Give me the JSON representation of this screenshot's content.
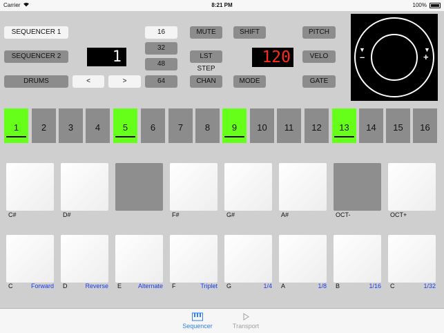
{
  "status_bar": {
    "carrier": "Carrier",
    "wifi_icon": "wifi-icon",
    "time": "8:21 PM",
    "battery": "100%"
  },
  "left_buttons": {
    "sequencer1": "SEQUENCER 1",
    "sequencer2": "SEQUENCER 2",
    "drums": "DRUMS",
    "prev": "<",
    "next": ">"
  },
  "channel_display": "1",
  "length_buttons": [
    "16",
    "32",
    "48",
    "64"
  ],
  "mid_buttons": {
    "mute": "MUTE",
    "shift": "SHIFT",
    "lst_step": "LST STEP",
    "chan": "CHAN",
    "mode": "MODE"
  },
  "tempo_display": "120",
  "right_buttons": {
    "pitch": "PITCH",
    "velo": "VELO",
    "gate": "GATE"
  },
  "joystick": {
    "left_arrow": "▼",
    "right_arrow": "▼",
    "minus": "–",
    "plus": "+"
  },
  "steps": [
    {
      "label": "1",
      "active": true
    },
    {
      "label": "2",
      "active": false
    },
    {
      "label": "3",
      "active": false
    },
    {
      "label": "4",
      "active": false
    },
    {
      "label": "5",
      "active": true
    },
    {
      "label": "6",
      "active": false
    },
    {
      "label": "7",
      "active": false
    },
    {
      "label": "8",
      "active": false
    },
    {
      "label": "9",
      "active": true
    },
    {
      "label": "10",
      "active": false
    },
    {
      "label": "11",
      "active": false
    },
    {
      "label": "12",
      "active": false
    },
    {
      "label": "13",
      "active": true
    },
    {
      "label": "14",
      "active": false
    },
    {
      "label": "15",
      "active": false
    },
    {
      "label": "16",
      "active": false
    }
  ],
  "top_pads": [
    {
      "note": "C#",
      "style": "white"
    },
    {
      "note": "D#",
      "style": "white"
    },
    {
      "note": "",
      "style": "gray"
    },
    {
      "note": "F#",
      "style": "white"
    },
    {
      "note": "G#",
      "style": "white"
    },
    {
      "note": "A#",
      "style": "white"
    },
    {
      "note": "OCT-",
      "style": "gray"
    },
    {
      "note": "OCT+",
      "style": "white"
    }
  ],
  "bottom_pads": [
    {
      "note": "C",
      "mode": "Forward"
    },
    {
      "note": "D",
      "mode": "Reverse"
    },
    {
      "note": "E",
      "mode": "Alternate"
    },
    {
      "note": "F",
      "mode": "Triplet"
    },
    {
      "note": "G",
      "mode": "1/4"
    },
    {
      "note": "A",
      "mode": "1/8"
    },
    {
      "note": "B",
      "mode": "1/16"
    },
    {
      "note": "C",
      "mode": "1/32"
    }
  ],
  "tabs": [
    {
      "label": "Sequencer",
      "icon": "keyboard-icon",
      "selected": true
    },
    {
      "label": "Transport",
      "icon": "play-icon",
      "selected": false
    }
  ],
  "colors": {
    "step_active": "#66ff1a",
    "lcd_red": "#ff2a1a",
    "mode_blue": "#1a3cf0",
    "tab_selected": "#2f7ff5"
  }
}
